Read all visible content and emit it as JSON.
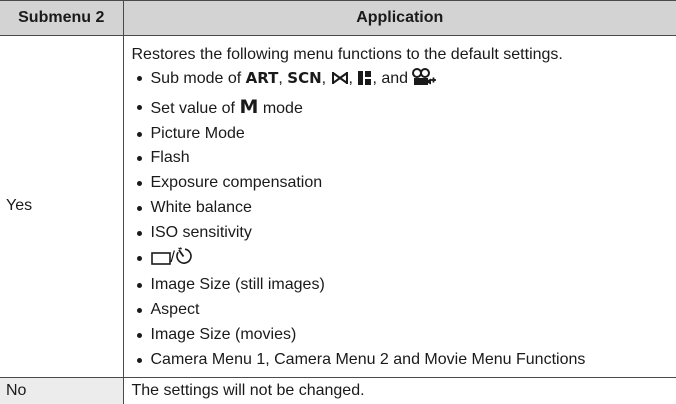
{
  "table": {
    "headers": [
      "Submenu 2",
      "Application"
    ],
    "rows": [
      {
        "submenu": "Yes",
        "intro": "Restores the following menu functions to the default settings.",
        "items": [
          {
            "prefix": "Sub mode of ",
            "mode1": "ART",
            "sep1": ", ",
            "mode2": "SCN",
            "sep2": ", ",
            "icon1": "panorama-icon",
            "sep3": ", ",
            "icon2": "photo-story-icon",
            "sep4": ", and ",
            "icon3": "movie-effect-icon"
          },
          {
            "prefix": "Set value of ",
            "mode": "M",
            "suffix": " mode"
          },
          "Picture Mode",
          "Flash",
          "Exposure compensation",
          "White balance",
          "ISO sensitivity",
          {
            "icons": [
              "single-frame-icon",
              "self-timer-icon"
            ],
            "slash": "/"
          },
          "Image Size (still images)",
          "Aspect",
          "Image Size (movies)",
          "Camera Menu 1, Camera Menu 2 and Movie Menu Functions"
        ]
      },
      {
        "submenu": "No",
        "text": "The settings will not be changed."
      }
    ]
  }
}
